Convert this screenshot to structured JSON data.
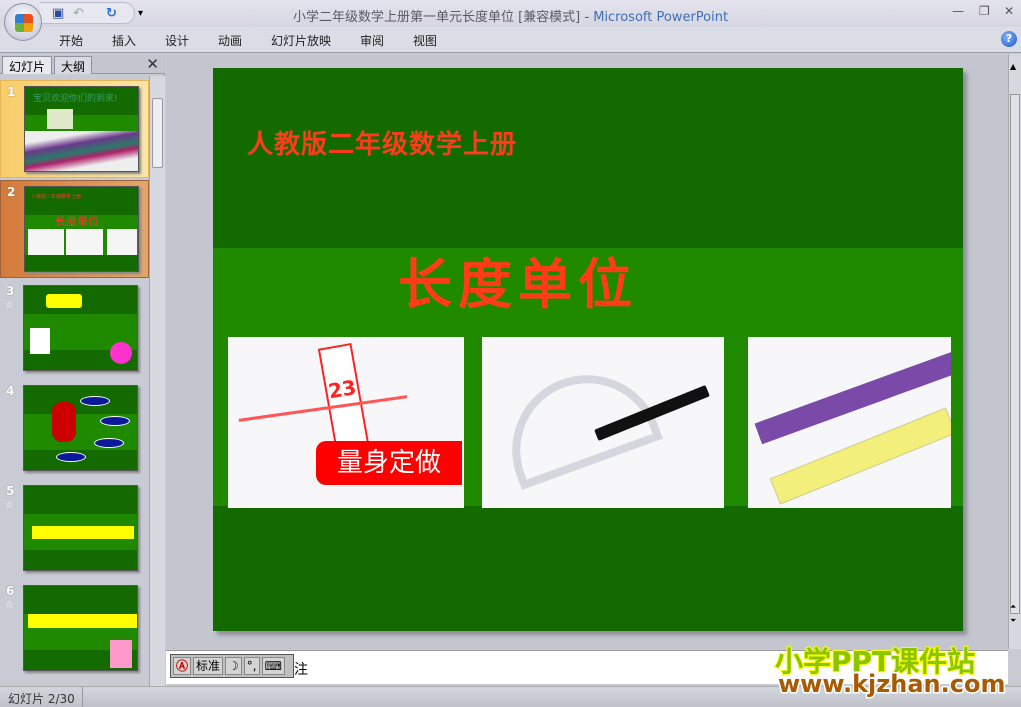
{
  "window": {
    "title_doc": "小学二年级数学上册第一单元长度单位 [兼容模式]",
    "title_sep": " - ",
    "title_app": "Microsoft PowerPoint",
    "minimize": "—",
    "restore": "❐",
    "close": "✕"
  },
  "quick_access": {
    "save": "save-icon",
    "undo": "undo-icon",
    "redo": "redo-icon",
    "customize": "▾"
  },
  "ribbon": {
    "tabs": [
      "开始",
      "插入",
      "设计",
      "动画",
      "幻灯片放映",
      "审阅",
      "视图"
    ],
    "help": "?"
  },
  "panel": {
    "tabs": [
      "幻灯片",
      "大纲"
    ],
    "close": "✕"
  },
  "thumbnails": [
    {
      "num": "1",
      "title": "宝贝欢迎你们的到来!"
    },
    {
      "num": "2",
      "title": "人教版二年级数学上册",
      "heading": "长度单位"
    },
    {
      "num": "3",
      "star": "☆"
    },
    {
      "num": "4"
    },
    {
      "num": "5",
      "star": "☆"
    },
    {
      "num": "6",
      "star": "☆"
    }
  ],
  "slide": {
    "subtitle": "人教版二年级数学上册",
    "title": "长度单位",
    "image1_text": "量身定做",
    "image1_numbers": "23"
  },
  "notes": {
    "visible_char": "注"
  },
  "ime": {
    "mode": "标准",
    "moon": "☽",
    "punct": "°,"
  },
  "status": {
    "slide_count": "幻灯片 2/30"
  },
  "watermark": {
    "line1": "小学PPT课件站",
    "line2": "www.kjzhan.com"
  },
  "colors": {
    "slide_dark": "#136b00",
    "slide_light": "#1f8a00",
    "title_red": "#ff3b1a"
  }
}
